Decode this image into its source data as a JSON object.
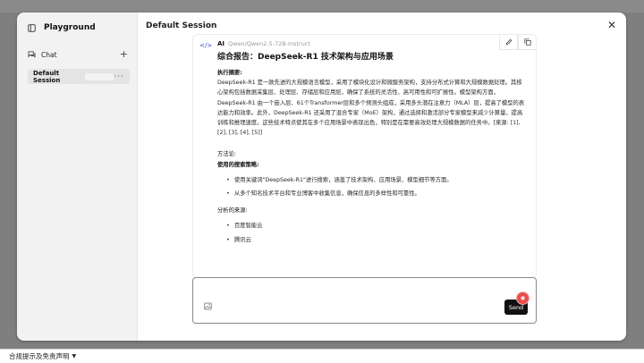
{
  "footer": {
    "disclaimer_label": "合规提示及免责声明"
  },
  "sidebar": {
    "title": "Playground",
    "chat_label": "Chat",
    "sessions": [
      {
        "label": "Default Session"
      }
    ]
  },
  "main": {
    "title": "Default Session"
  },
  "message": {
    "sender": "AI",
    "model": "Qwen/Qwen2.5-72B-Instruct",
    "heading": "综合报告：DeepSeek-R1 技术架构与应用场景",
    "summary_title": "执行摘要:",
    "summary_body": "DeepSeek-R1 是一款先进的大规模语言模型，采用了模块化设计和微服务架构，支持分布式计算和大规模数据处理。其核心架构包括数据采集层、处理层、存储层和应用层，确保了系统的灵活性、高可用性和可扩展性。模型架构方面，DeepSeek-R1 由一个嵌入层、61个Transformer层和多个预测头组成，采用多头潜在注意力（MLA）层，提高了模型的表达能力和效率。此外，DeepSeek-R1 还采用了混合专家（MoE）架构，通过选择和激活部分专家模型来减少计算量，提高训练和推理速度。这些技术特点使其在多个应用场景中表现出色，特别是在需要高效处理大规模数据的任务中。[来源: [1], [2], [3], [4], [5]]",
    "methods_title": "方法论:",
    "strategy_title": "使用的搜索策略:",
    "strategy_items": [
      "使用关键词\"DeepSeek-R1\"进行搜索，涵盖了技术架构、应用场景、模型细节等方面。",
      "从多个知名技术平台和专业博客中收集信息，确保信息的多样性和可靠性。"
    ],
    "sources_title": "分析的来源:",
    "sources_items": [
      "百度智能云",
      "腾讯云"
    ]
  },
  "composer": {
    "placeholder": "",
    "send_label": "Send"
  }
}
